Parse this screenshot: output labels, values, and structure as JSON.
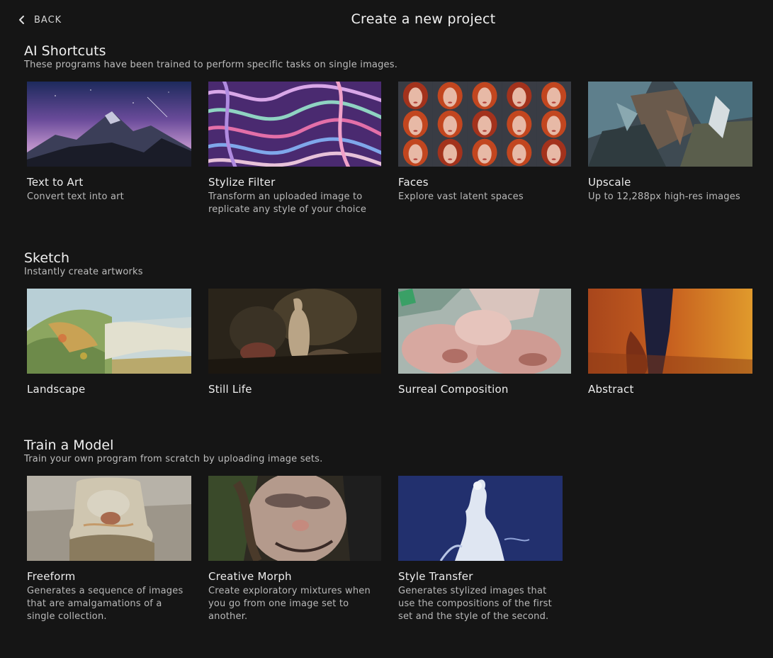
{
  "header": {
    "back_label": "BACK",
    "title": "Create a new project"
  },
  "sections": [
    {
      "title": "AI Shortcuts",
      "subtitle": "These programs have been trained to perform specific tasks on single images.",
      "cards": [
        {
          "title": "Text to Art",
          "desc": "Convert text into art"
        },
        {
          "title": "Stylize Filter",
          "desc": "Transform an uploaded image to replicate any style of your choice"
        },
        {
          "title": "Faces",
          "desc": "Explore vast latent spaces"
        },
        {
          "title": "Upscale",
          "desc": "Up to 12,288px high-res images"
        }
      ]
    },
    {
      "title": "Sketch",
      "subtitle": "Instantly create artworks",
      "cards": [
        {
          "title": "Landscape"
        },
        {
          "title": "Still Life"
        },
        {
          "title": "Surreal Composition"
        },
        {
          "title": "Abstract"
        }
      ]
    },
    {
      "title": "Train a Model",
      "subtitle": "Train your own program from scratch by uploading image sets.",
      "cards": [
        {
          "title": "Freeform",
          "desc": "Generates a sequence of images that are amalgamations of a single collection."
        },
        {
          "title": "Creative Morph",
          "desc": "Create exploratory mixtures when you go from one image set to another."
        },
        {
          "title": "Style Transfer",
          "desc": "Generates stylized images that use the compositions of the first set and the style of the second."
        }
      ]
    }
  ]
}
